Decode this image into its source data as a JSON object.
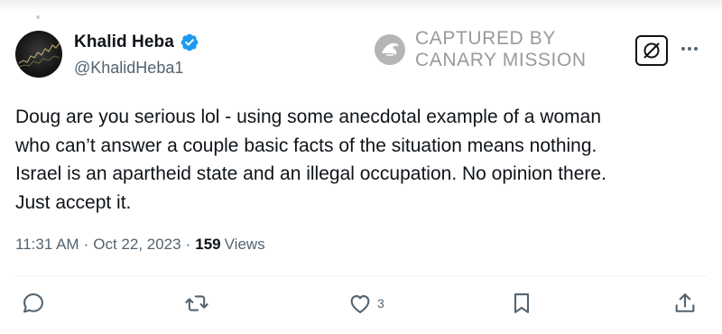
{
  "author": {
    "display_name": "Khalid Heba",
    "handle": "@KhalidHeba1",
    "verified": true,
    "verified_color": "#1d9bf0"
  },
  "watermark": {
    "line1": "CAPTURED BY",
    "line2": "CANARY MISSION",
    "color": "#9a9a9a"
  },
  "tweet": {
    "lines": [
      "Doug are you serious lol - using some anecdotal example of a woman",
      "who can’t answer a couple basic facts of the situation means nothing.",
      "Israel is an apartheid state and an illegal occupation. No opinion there.",
      "Just accept it."
    ]
  },
  "meta": {
    "time": "11:31 AM",
    "separator": "·",
    "date": "Oct 22, 2023",
    "views_count": "159",
    "views_label": "Views"
  },
  "actions": {
    "like_count": "3"
  },
  "icons": {
    "verified": "verified-badge-icon",
    "grok": "grok-icon",
    "more": "more-icon",
    "reply": "reply-icon",
    "retweet": "retweet-icon",
    "like": "heart-icon",
    "bookmark": "bookmark-icon",
    "share": "share-icon"
  },
  "colors": {
    "text": "#0f1419",
    "secondary": "#536471",
    "divider": "#eff3f4"
  }
}
